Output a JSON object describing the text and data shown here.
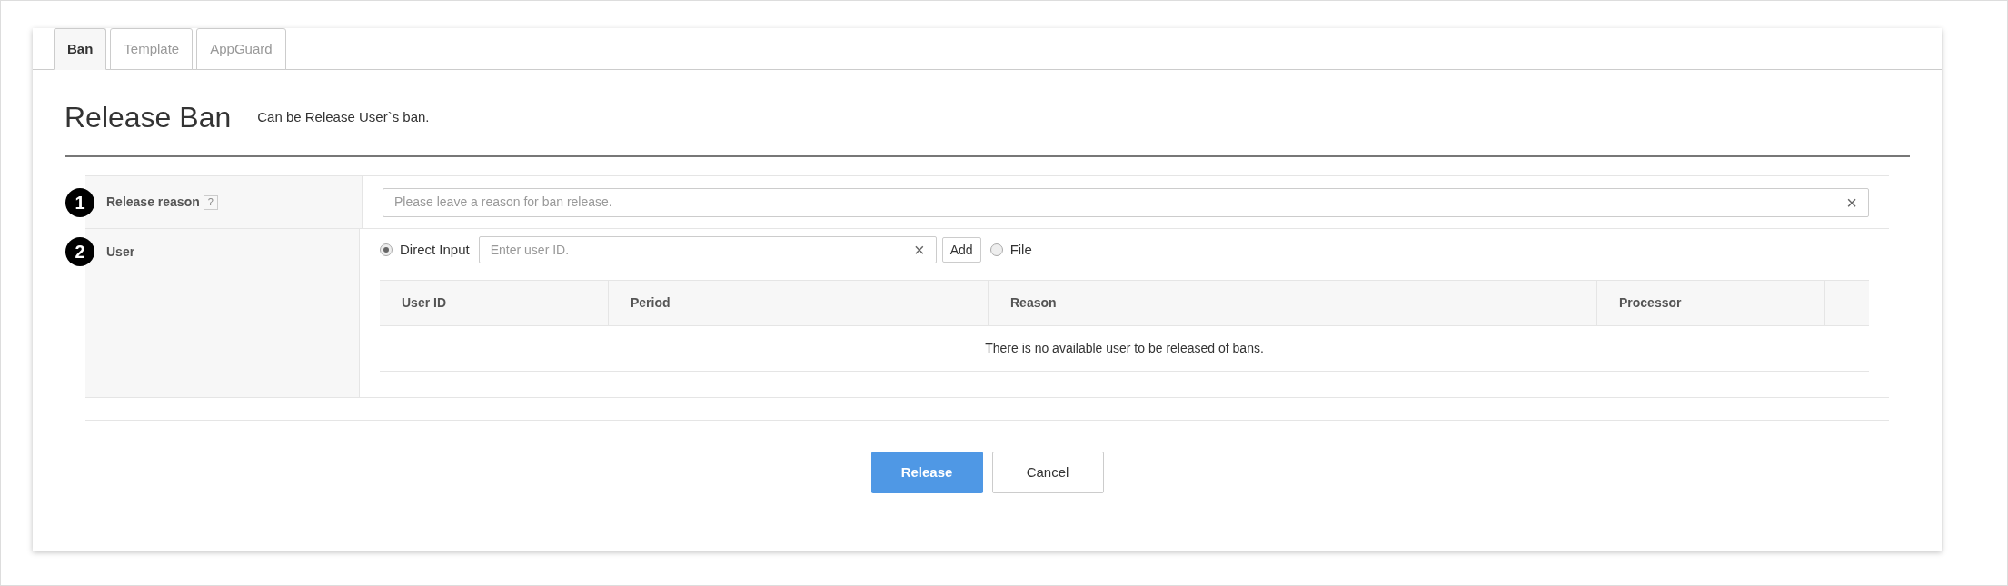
{
  "tabs": [
    {
      "label": "Ban",
      "selected": true
    },
    {
      "label": "Template",
      "selected": false
    },
    {
      "label": "AppGuard",
      "selected": false
    }
  ],
  "header": {
    "title": "Release Ban",
    "subtitle": "Can be Release User`s ban."
  },
  "form": {
    "reason": {
      "number": "1",
      "label": "Release reason",
      "help": "?",
      "placeholder": "Please leave a reason for ban release.",
      "clear": "×"
    },
    "user": {
      "number": "2",
      "label": "User",
      "options": [
        {
          "label": "Direct Input",
          "selected": true
        },
        {
          "label": "File",
          "selected": false
        }
      ],
      "input": {
        "placeholder": "Enter user ID.",
        "clear": "×"
      },
      "add_button": "Add",
      "table": {
        "columns": [
          "User ID",
          "Period",
          "Reason",
          "Processor",
          ""
        ],
        "empty_message": "There is no available user to be released of bans."
      }
    }
  },
  "buttons": [
    {
      "label": "Release",
      "kind": "primary"
    },
    {
      "label": "Cancel",
      "kind": "secondary"
    }
  ]
}
